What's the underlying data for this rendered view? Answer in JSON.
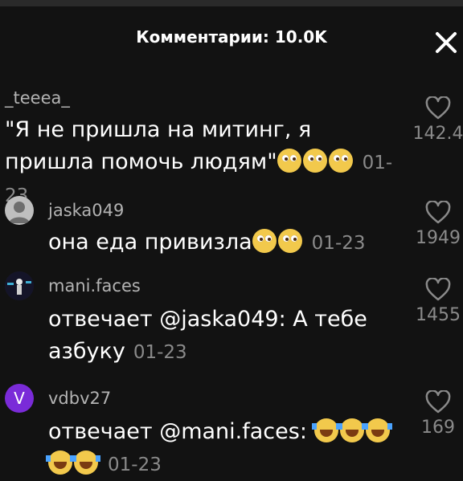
{
  "header": {
    "title": "Комментарии: 10.0K"
  },
  "comments": [
    {
      "username": "_teeea_",
      "text": "\"Я не пришла на митинг, я пришла помочь людям\"",
      "emoji": [
        "pleading-face",
        "pleading-face",
        "pleading-face"
      ],
      "date": "01-23",
      "likes": "142.4"
    },
    {
      "username": "jaska049",
      "avatar_icon": "default-user-avatar",
      "text": "она еда привизла",
      "emoji": [
        "pleading-face",
        "pleading-face"
      ],
      "date": "01-23",
      "likes": "1949"
    },
    {
      "username": "mani.faces",
      "avatar_icon": "profile-photo-avatar",
      "reply_prefix": "отвечает ",
      "mention": "@jaska049",
      "text": ": А тебе азбуку",
      "date": "01-23",
      "likes": "1455"
    },
    {
      "username": "vdbv27",
      "avatar_letter": "V",
      "reply_prefix": "отвечает ",
      "mention": "@mani.faces",
      "text": ":",
      "emoji": [
        "laughing-tears-face",
        "laughing-tears-face",
        "laughing-tears-face",
        "laughing-tears-face",
        "laughing-tears-face"
      ],
      "date": "01-23",
      "likes": "169"
    }
  ],
  "colors": {
    "background": "#121212",
    "username": "#b3b3b3",
    "date": "#8a8a8a",
    "avatar_violet": "#7a2bd8"
  }
}
